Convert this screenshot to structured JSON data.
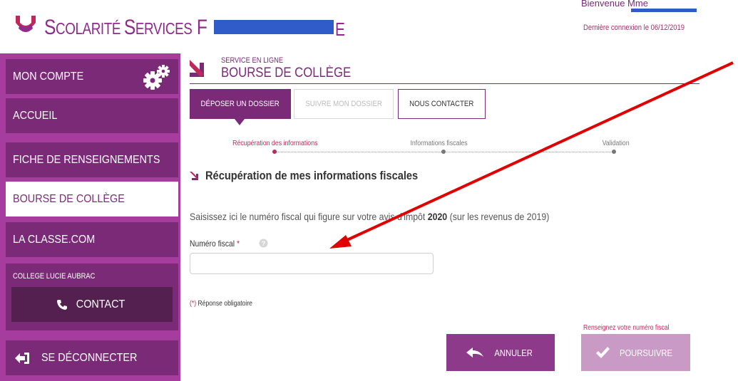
{
  "header": {
    "brand_prefix": "S",
    "brand_small": "COLARITÉ ",
    "brand_prefix2": "S",
    "brand_small2": "ERVICES",
    "brand_cut": " F",
    "brand_tail": "E",
    "welcome": "Bienvenue Mme",
    "last_login": "Dernière connexion le 06/12/2019"
  },
  "sidebar": {
    "items": [
      {
        "label": "MON COMPTE"
      },
      {
        "label": "ACCUEIL"
      },
      {
        "label": "FICHE DE RENSEIGNEMENTS"
      },
      {
        "label": "BOURSE DE COLLÈGE"
      },
      {
        "label": "LA CLASSE.COM"
      }
    ],
    "college_name": "COLLEGE LUCIE AUBRAC",
    "contact_label": "CONTACT",
    "logout_label": "SE DÉCONNECTER"
  },
  "service": {
    "subtitle": "SERVICE EN LIGNE",
    "title": "BOURSE DE COLLÈGE"
  },
  "tabs": [
    {
      "label": "DÉPOSER UN DOSSIER"
    },
    {
      "label": "SUIVRE MON DOSSIER"
    },
    {
      "label": "NOUS CONTACTER"
    }
  ],
  "steps": [
    {
      "label": "Récupération des informations"
    },
    {
      "label": "Informations fiscales"
    },
    {
      "label": "Validation"
    }
  ],
  "section": {
    "title": "Récupération de mes informations fiscales",
    "instruction_before": "Saisissez ici le numéro fiscal qui figure sur votre avis d'impôt ",
    "instruction_year": "2020",
    "instruction_after": " (sur les revenus de 2019)"
  },
  "form": {
    "fiscal_label": "Numéro fiscal",
    "required_mark": "*",
    "fiscal_value": "",
    "required_note_mark": "(*)",
    "required_note": " Réponse obligatoire",
    "error_message": "Renseignez votre numéro fiscal"
  },
  "buttons": {
    "cancel": "ANNULER",
    "submit": "POURSUIVRE"
  },
  "colors": {
    "brand_purple": "#7b2a78",
    "sidebar_purple": "#a63c9e",
    "accent_red": "#c0285a",
    "redaction_blue": "#2f5cc9",
    "annotation_arrow": "#e00000"
  },
  "icons": [
    "brand-logo",
    "gear-icon",
    "phone-icon",
    "logout-icon",
    "service-arrow-icon",
    "help-icon",
    "back-arrow-icon",
    "check-icon"
  ]
}
